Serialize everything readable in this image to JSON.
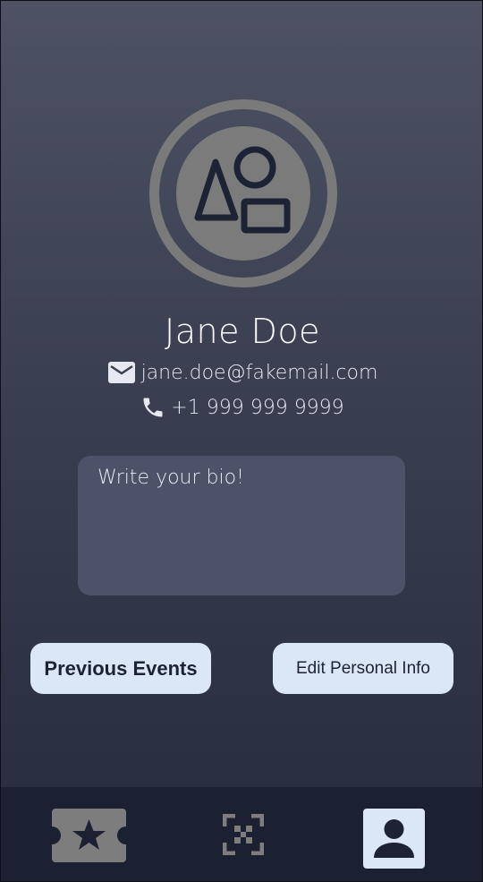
{
  "profile": {
    "name": "Jane Doe",
    "email": "jane.doe@fakemail.com",
    "phone": "+1 999 999 9999",
    "avatar_icon": "shapes-placeholder-icon",
    "email_icon": "mail-icon",
    "phone_icon": "phone-icon"
  },
  "bio": {
    "placeholder": "Write your bio!"
  },
  "actions": {
    "previous_events_label": "Previous Events",
    "edit_info_label": "Edit Personal Info"
  },
  "nav": {
    "items": [
      {
        "icon": "ticket-star-icon",
        "active": false
      },
      {
        "icon": "qr-scan-icon",
        "active": false
      },
      {
        "icon": "account-icon",
        "active": true
      }
    ]
  },
  "colors": {
    "button_bg": "#dbe7f6",
    "nav_bg": "#1b2032",
    "accent_dark": "#1d2235"
  }
}
